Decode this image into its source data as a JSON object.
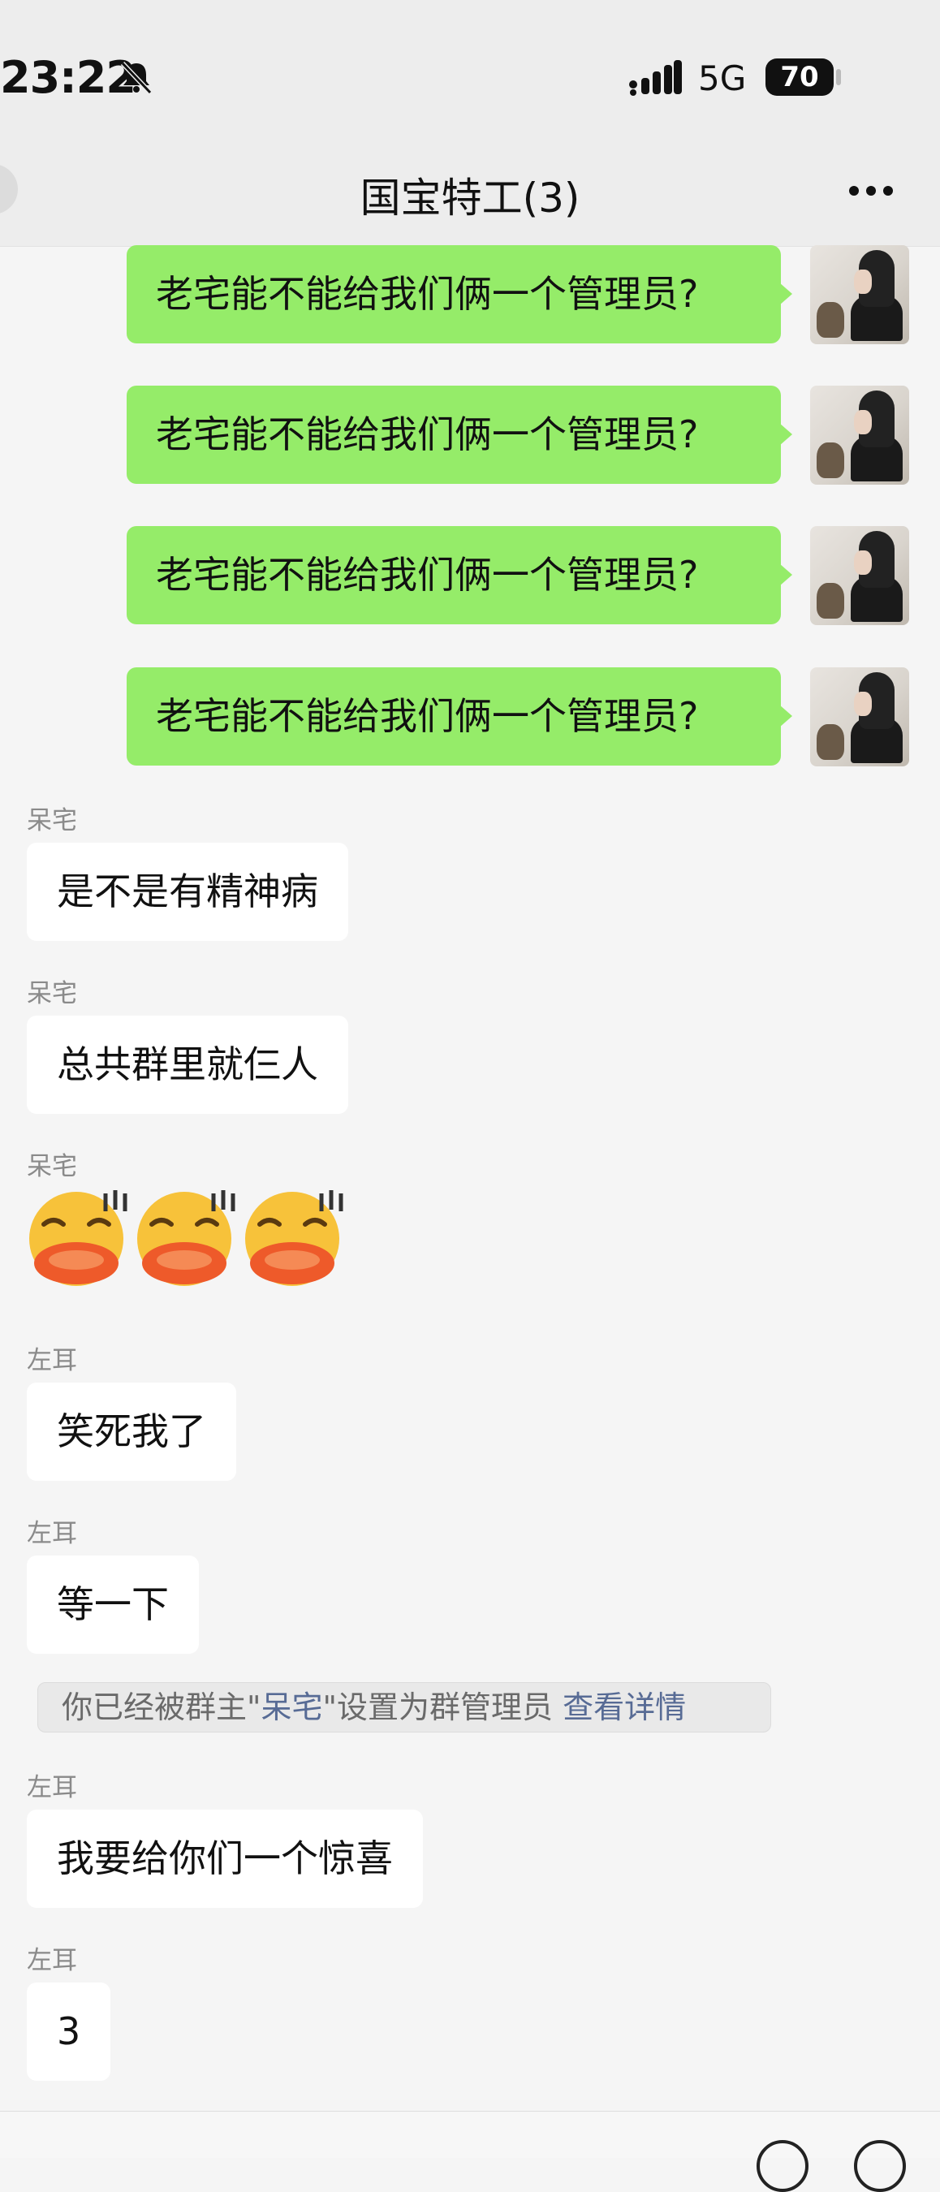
{
  "status_bar": {
    "time": "23:22",
    "network": "5G",
    "battery": "70",
    "icons": [
      "bell-muted-icon",
      "signal-icon"
    ]
  },
  "header": {
    "title": "国宝特工(3)",
    "icons": [
      "back-icon",
      "more-dots-icon"
    ]
  },
  "messages": {
    "outgoing": [
      {
        "text": "老宅能不能给我们俩一个管理员?"
      },
      {
        "text": "老宅能不能给我们俩一个管理员?"
      },
      {
        "text": "老宅能不能给我们俩一个管理员?"
      },
      {
        "text": "老宅能不能给我们俩一个管理员?"
      }
    ],
    "incoming": [
      {
        "sender": "呆宅",
        "text": "是不是有精神病"
      },
      {
        "sender": "呆宅",
        "text": "总共群里就仨人"
      },
      {
        "sender": "呆宅",
        "emojis": [
          "laughing-tears-emoji",
          "laughing-tears-emoji",
          "laughing-tears-emoji"
        ]
      },
      {
        "sender": "左耳",
        "text": "笑死我了"
      },
      {
        "sender": "左耳",
        "text": "等一下"
      },
      {
        "sender": "左耳",
        "text": "我要给你们一个惊喜"
      },
      {
        "sender": "左耳",
        "text": "3"
      }
    ]
  },
  "system_notice": {
    "prefix": "你已经被群主\"",
    "name": "呆宅",
    "suffix": "\"设置为群管理员",
    "link": "查看详情"
  },
  "colors": {
    "outgoing_bubble": "#95ec69",
    "incoming_bubble": "#ffffff",
    "link": "#576b95",
    "background": "#f5f5f5"
  }
}
